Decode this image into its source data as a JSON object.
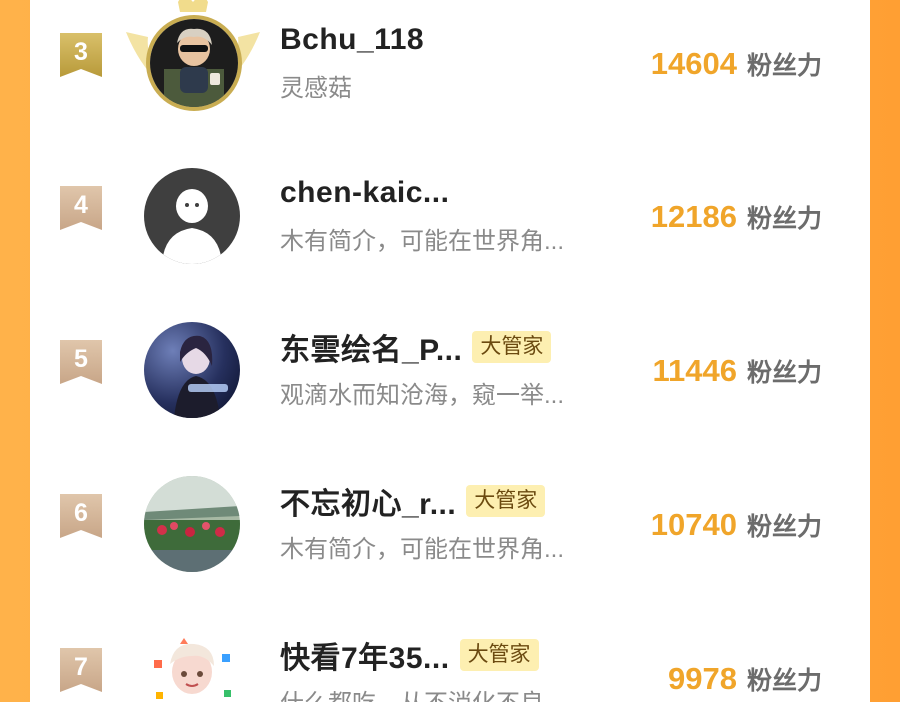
{
  "colors": {
    "background": "#ff9f33",
    "score": "#f0a52a",
    "badge_gold": "#c9ad52",
    "badge_tan": "#d7b99b",
    "role_badge_bg": "#fdefb1"
  },
  "ranking": {
    "score_unit": "粉丝力",
    "role_label": "大管家",
    "rows": [
      {
        "rank": "3",
        "name": "Bchu_118",
        "subtitle": "灵感菇",
        "score": "14604",
        "has_role": false,
        "avatar_icon": "cartoon-boy-avatar-icon"
      },
      {
        "rank": "4",
        "name": "chen-kaic...",
        "subtitle": "木有简介，可能在世界角...",
        "score": "12186",
        "has_role": false,
        "avatar_icon": "default-user-avatar-icon"
      },
      {
        "rank": "5",
        "name": "东雲绘名_P...",
        "subtitle": "观滴水而知沧海，窥一举...",
        "score": "11446",
        "has_role": true,
        "avatar_icon": "anime-girl-avatar-icon"
      },
      {
        "rank": "6",
        "name": "不忘初心_r...",
        "subtitle": "木有简介，可能在世界角...",
        "score": "10740",
        "has_role": true,
        "avatar_icon": "flower-garden-avatar-icon"
      },
      {
        "rank": "7",
        "name": "快看7年35...",
        "subtitle": "什么都吃，从不消化不良",
        "score": "9978",
        "has_role": true,
        "avatar_icon": "sticker-character-avatar-icon"
      }
    ]
  }
}
